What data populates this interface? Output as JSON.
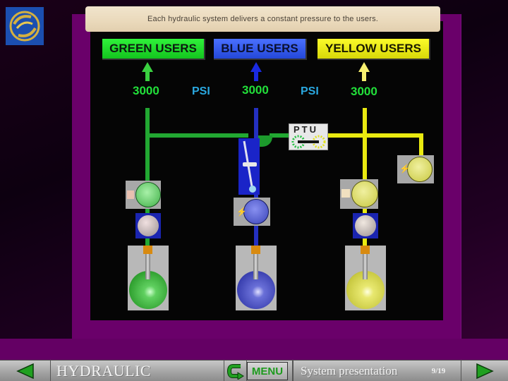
{
  "banner": {
    "text": "Each hydraulic system delivers a constant pressure to the users."
  },
  "users": {
    "green": {
      "label": "GREEN USERS",
      "color": "#22e03a"
    },
    "blue": {
      "label": "BLUE USERS",
      "color": "#2448d8"
    },
    "yellow": {
      "label": "YELLOW USERS",
      "color": "#eaea10"
    }
  },
  "pressures": {
    "green": "3000",
    "blue": "3000",
    "yellow": "3000",
    "unit_left": "PSI",
    "unit_right": "PSI"
  },
  "ptu": {
    "label": "PTU"
  },
  "components": {
    "green": [
      "electric-pump",
      "engine-pump",
      "reservoir"
    ],
    "blue": [
      "ram-air-turbine",
      "electric-pump",
      "reservoir"
    ],
    "yellow": [
      "electric-pump",
      "engine-pump",
      "reservoir",
      "hand-pump"
    ]
  },
  "footer": {
    "title": "HYDRAULIC",
    "menu_label": "MENU",
    "subtitle": "System presentation",
    "page": "9/19",
    "prev_icon": "triangle-left-icon",
    "next_icon": "triangle-right-icon",
    "return_icon": "return-arrow-icon"
  }
}
